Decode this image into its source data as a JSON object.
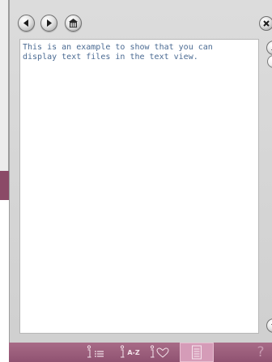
{
  "text_view": {
    "lines": [
      "This is an example to show that you can",
      "display text files in the text view."
    ]
  },
  "toolbar": {
    "az_label": "A-Z",
    "help_glyph": "?"
  },
  "icons": {
    "back": "arrow-left-icon",
    "forward": "arrow-right-icon",
    "home": "home-icon",
    "close": "close-icon",
    "scroll_up": "chevron-up-icon",
    "scroll_down": "chevron-down-icon"
  },
  "colors": {
    "toolbar_bg": "#9a5d7b",
    "toolbar_active": "#d59cb8",
    "text_color": "#4a6a92"
  }
}
